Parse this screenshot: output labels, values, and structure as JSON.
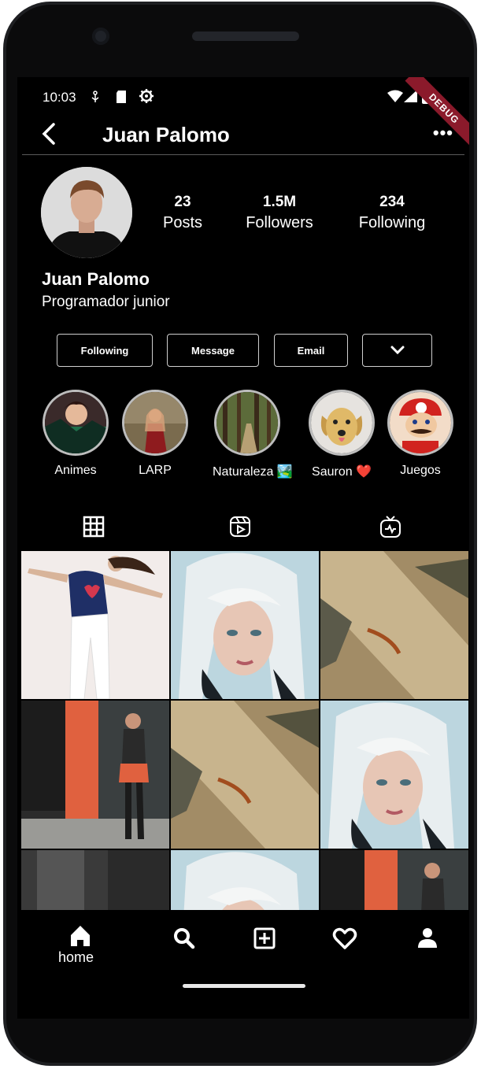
{
  "status_bar": {
    "time": "10:03",
    "debug_banner": "DEBUG"
  },
  "app_bar": {
    "title": "Juan Palomo"
  },
  "profile": {
    "name": "Juan Palomo",
    "bio": "Programador junior",
    "stats": [
      {
        "value": "23",
        "label": "Posts"
      },
      {
        "value": "1.5M",
        "label": "Followers"
      },
      {
        "value": "234",
        "label": "Following"
      }
    ]
  },
  "actions": {
    "following": "Following",
    "message": "Message",
    "email": "Email"
  },
  "highlights": [
    {
      "label": "Animes"
    },
    {
      "label": "LARP"
    },
    {
      "label": "Naturaleza 🏞️"
    },
    {
      "label": "Sauron ❤️"
    },
    {
      "label": "Juegos"
    }
  ],
  "tabs": [
    "grid-icon",
    "reels-icon",
    "igtv-icon"
  ],
  "bottom_nav": {
    "home_label": "home"
  },
  "colors": {
    "background": "#000000",
    "text": "#ffffff",
    "debug": "#8b1a2b"
  }
}
